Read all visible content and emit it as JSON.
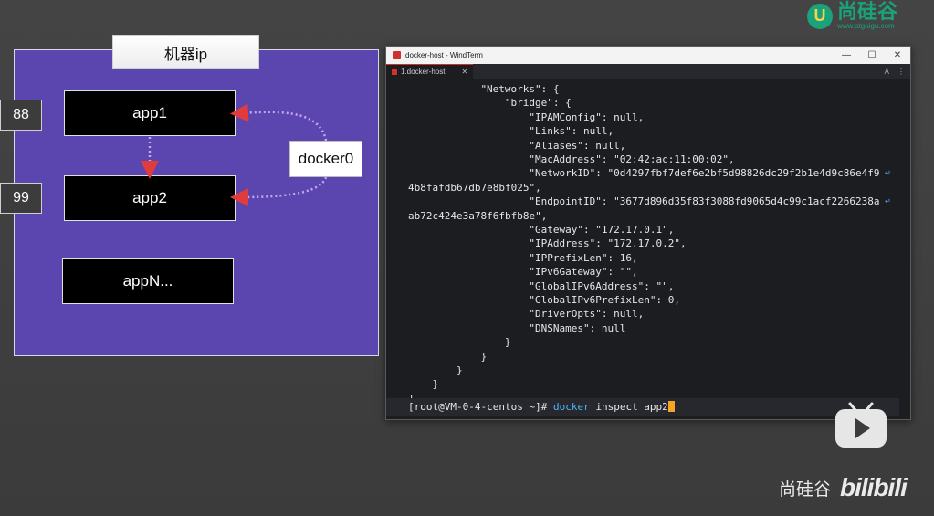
{
  "diagram": {
    "host_label": "机器ip",
    "apps": [
      {
        "label": "app1"
      },
      {
        "label": "app2"
      },
      {
        "label": "appN..."
      }
    ],
    "ports": [
      "88",
      "99"
    ],
    "bridge_label": "docker0",
    "colors": {
      "host_bg": "#5b46b0",
      "arrow": "#e03c3c",
      "dots": "#c9a6f0"
    }
  },
  "terminal": {
    "window_title": "docker-host - WindTerm",
    "tab_label": "1.docker-host",
    "tab_tools": [
      "A",
      "⋮"
    ],
    "lines": [
      {
        "indent": "            ",
        "text": "\"Networks\": {"
      },
      {
        "indent": "                ",
        "text": "\"bridge\": {"
      },
      {
        "indent": "                    ",
        "text": "\"IPAMConfig\": null,"
      },
      {
        "indent": "                    ",
        "text": "\"Links\": null,"
      },
      {
        "indent": "                    ",
        "text": "\"Aliases\": null,"
      },
      {
        "indent": "                    ",
        "text": "\"MacAddress\": \"02:42:ac:11:00:02\","
      },
      {
        "indent": "                    ",
        "text": "\"NetworkID\": \"0d4297fbf7def6e2bf5d98826dc29f2b1e4d9c86e4f9",
        "wrap": true
      },
      {
        "indent": "",
        "text": "4b8fafdb67db7e8bf025\","
      },
      {
        "indent": "                    ",
        "text": "\"EndpointID\": \"3677d896d35f83f3088fd9065d4c99c1acf2266238a",
        "wrap": true
      },
      {
        "indent": "",
        "text": "ab72c424e3a78f6fbfb8e\","
      },
      {
        "indent": "                    ",
        "text": "\"Gateway\": \"172.17.0.1\","
      },
      {
        "indent": "                    ",
        "text": "\"IPAddress\": \"172.17.0.2\","
      },
      {
        "indent": "                    ",
        "text": "\"IPPrefixLen\": 16,"
      },
      {
        "indent": "                    ",
        "text": "\"IPv6Gateway\": \"\","
      },
      {
        "indent": "                    ",
        "text": "\"GlobalIPv6Address\": \"\","
      },
      {
        "indent": "                    ",
        "text": "\"GlobalIPv6PrefixLen\": 0,"
      },
      {
        "indent": "                    ",
        "text": "\"DriverOpts\": null,"
      },
      {
        "indent": "                    ",
        "text": "\"DNSNames\": null"
      },
      {
        "indent": "                ",
        "text": "}"
      },
      {
        "indent": "            ",
        "text": "}"
      },
      {
        "indent": "        ",
        "text": "}"
      },
      {
        "indent": "    ",
        "text": "}"
      },
      {
        "indent": "",
        "text": "]"
      }
    ],
    "prompt": "[root@VM-0-4-centos ~]#",
    "command_keyword": "docker",
    "command_rest": "inspect app2"
  },
  "watermarks": {
    "logo_cn": "尚硅谷",
    "logo_url": "www.atguigu.com",
    "bottom_cn": "尚硅谷",
    "bottom_brand": "bilibili",
    "logo_icon": "u-logo-icon",
    "play_icon": "bilibili-play-icon"
  }
}
